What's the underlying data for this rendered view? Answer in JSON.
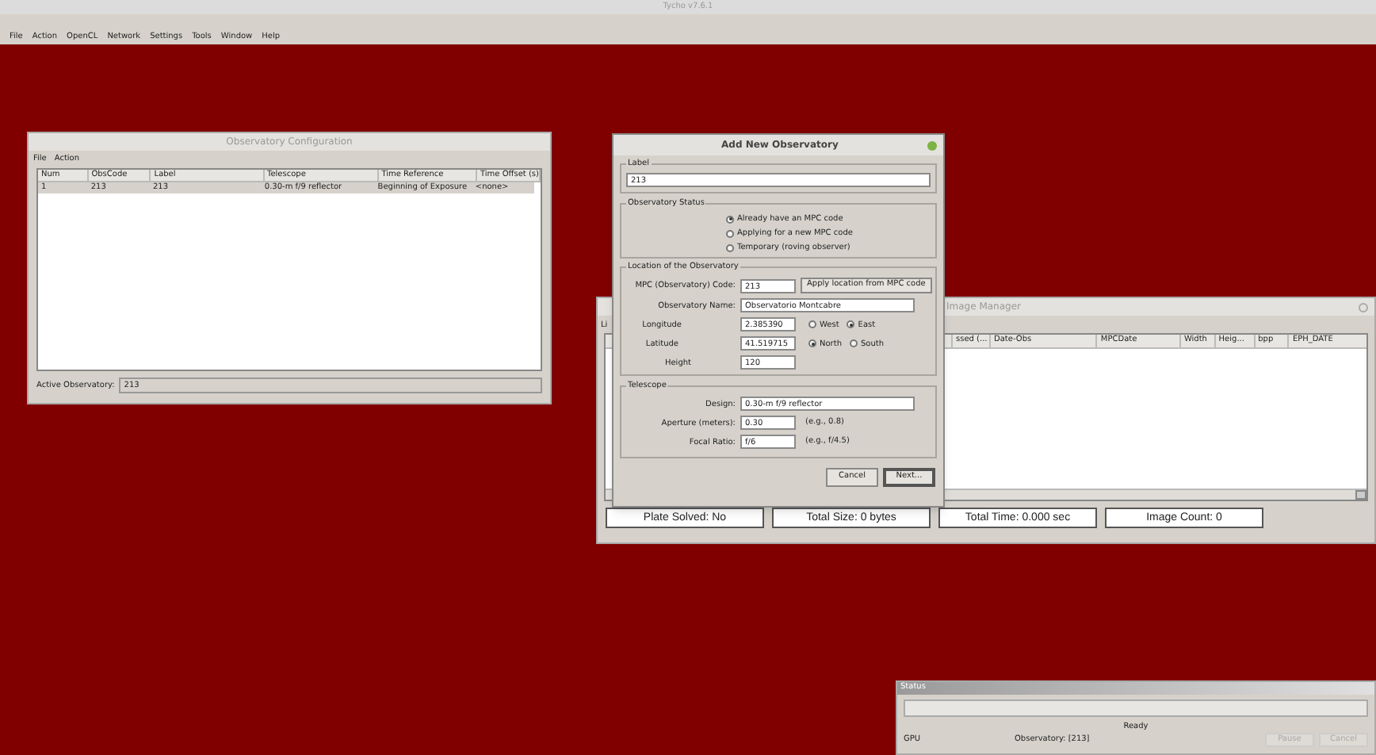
{
  "app_title": "Tycho v7.6.1",
  "menu": [
    "File",
    "Action",
    "OpenCL",
    "Network",
    "Settings",
    "Tools",
    "Window",
    "Help"
  ],
  "observatory_config": {
    "title": "Observatory Configuration",
    "menu": [
      "File",
      "Action"
    ],
    "columns": [
      "Num",
      "ObsCode",
      "Label",
      "Telescope",
      "Time Reference",
      "Time Offset (s)"
    ],
    "rows": [
      {
        "cells": [
          "1",
          "213",
          "213",
          "0.30-m f/9 reflector",
          "Beginning of Exposure",
          "<none>"
        ],
        "selected": true
      }
    ],
    "active_label": "Active Observatory:",
    "active_value": "213"
  },
  "image_manager": {
    "title": "Image Manager",
    "menu_fragment": "Li",
    "columns": [
      "ssed (...",
      "Date-Obs",
      "MPCDate",
      "Width",
      "Heig...",
      "bpp",
      "EPH_DATE"
    ],
    "status_fields": [
      "Plate Solved: No",
      "Total Size: 0 bytes",
      "Total Time: 0.000 sec",
      "Image Count: 0"
    ]
  },
  "dialog": {
    "title": "Add New Observatory",
    "label_group": {
      "title": "Label",
      "value": "213"
    },
    "status_group": {
      "title": "Observatory Status",
      "options": [
        {
          "label": "Already have an MPC code",
          "selected": true
        },
        {
          "label": "Applying for a new MPC code",
          "selected": false
        },
        {
          "label": "Temporary (roving observer)",
          "selected": false
        }
      ]
    },
    "location_group": {
      "title": "Location of the Observatory",
      "mpc_label": "MPC (Observatory) Code:",
      "mpc_value": "213",
      "apply_button": "Apply location from MPC code",
      "name_label": "Observatory Name:",
      "name_value": "Observatorio Montcabre",
      "longitude_label": "Longitude",
      "longitude_value": "2.385390",
      "longitude_options": [
        {
          "label": "West",
          "selected": false
        },
        {
          "label": "East",
          "selected": true
        }
      ],
      "latitude_label": "Latitude",
      "latitude_value": "41.519715",
      "latitude_options": [
        {
          "label": "North",
          "selected": true
        },
        {
          "label": "South",
          "selected": false
        }
      ],
      "height_label": "Height",
      "height_value": "120"
    },
    "telescope_group": {
      "title": "Telescope",
      "design_label": "Design:",
      "design_value": "0.30-m f/9 reflector",
      "aperture_label": "Aperture (meters):",
      "aperture_value": "0.30",
      "aperture_hint": "(e.g., 0.8)",
      "focal_label": "Focal Ratio:",
      "focal_value": "f/6",
      "focal_hint": "(e.g., f/4.5)"
    },
    "buttons": [
      {
        "label": "Cancel",
        "default": false
      },
      {
        "label": "Next...",
        "default": true
      }
    ]
  },
  "status_window": {
    "title": "Status",
    "progress": {
      "level": 0
    },
    "message": "Ready",
    "device": "GPU",
    "observatory": "Observatory: [213]",
    "buttons": [
      {
        "label": "Pause",
        "disabled": true
      },
      {
        "label": "Cancel",
        "disabled": true
      }
    ]
  }
}
